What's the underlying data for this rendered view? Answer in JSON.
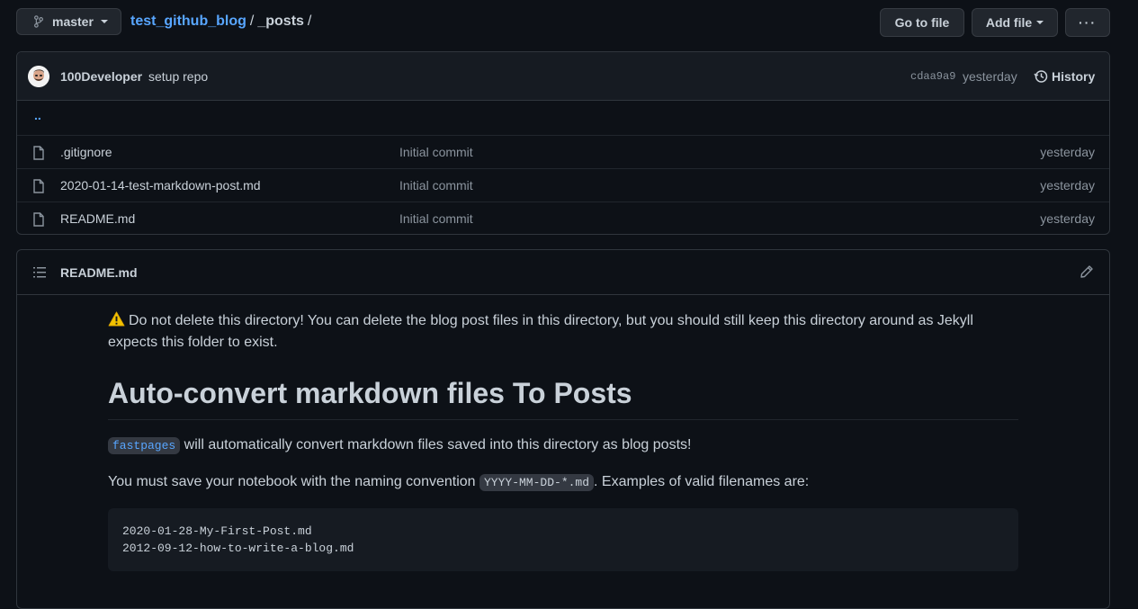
{
  "header": {
    "branch": "master",
    "repo": "test_github_blog",
    "separator": "/",
    "current_dir": "_posts",
    "trailing_sep": "/",
    "go_to_file": "Go to file",
    "add_file": "Add file",
    "more": "···"
  },
  "commit": {
    "author": "100Developer",
    "message": "setup repo",
    "sha": "cdaa9a9",
    "when": "yesterday",
    "history": "History"
  },
  "files": {
    "up": "..",
    "rows": [
      {
        "name": ".gitignore",
        "message": "Initial commit",
        "age": "yesterday"
      },
      {
        "name": "2020-01-14-test-markdown-post.md",
        "message": "Initial commit",
        "age": "yesterday"
      },
      {
        "name": "README.md",
        "message": "Initial commit",
        "age": "yesterday"
      }
    ]
  },
  "readme": {
    "title": "README.md",
    "warning": "Do not delete this directory! You can delete the blog post files in this directory, but you should still keep this directory around as Jekyll expects this folder to exist.",
    "heading": "Auto-convert markdown files To Posts",
    "p1_code": "fastpages",
    "p1_text": " will automatically convert markdown files saved into this directory as blog posts!",
    "p2_before": "You must save your notebook with the naming convention ",
    "p2_code": "YYYY-MM-DD-*.md",
    "p2_after": ". Examples of valid filenames are:",
    "code_line1": "2020-01-28-My-First-Post.md",
    "code_line2": "2012-09-12-how-to-write-a-blog.md"
  }
}
